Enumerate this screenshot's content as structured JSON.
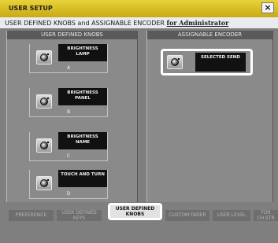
{
  "window": {
    "title": "USER SETUP",
    "close_label": "×"
  },
  "header": {
    "main_text": "USER DEFINED KNOBS and ASSIGNABLE ENCODER",
    "admin_link": "for Administrator"
  },
  "user_knobs": {
    "heading": "USER DEFINED KNOBS",
    "items": [
      {
        "line1": "BRIGHTNESS",
        "line2": "LAMP",
        "letter": "A"
      },
      {
        "line1": "BRIGHTNESS",
        "line2": "PANEL",
        "letter": "B"
      },
      {
        "line1": "BRIGHTNESS",
        "line2": "NAME",
        "letter": "C"
      },
      {
        "line1": "TOUCH AND TURN",
        "line2": "",
        "letter": "D"
      }
    ]
  },
  "assignable": {
    "heading": "ASSIGNABLE ENCODER",
    "display": "SELECTED SEND"
  },
  "tabs": [
    {
      "label": "PREFERENCE"
    },
    {
      "label": "USER DEFINED KEYS"
    },
    {
      "label": "USER DEFINED KNOBS"
    },
    {
      "label": "CUSTOM FADER"
    },
    {
      "label": "USER LEVEL"
    },
    {
      "label": "FOR CH.STR"
    }
  ],
  "colors": {
    "titlebar": "#d4b520",
    "background": "#7f7f7f",
    "display": "#111111",
    "highlight": "#ffffff"
  }
}
